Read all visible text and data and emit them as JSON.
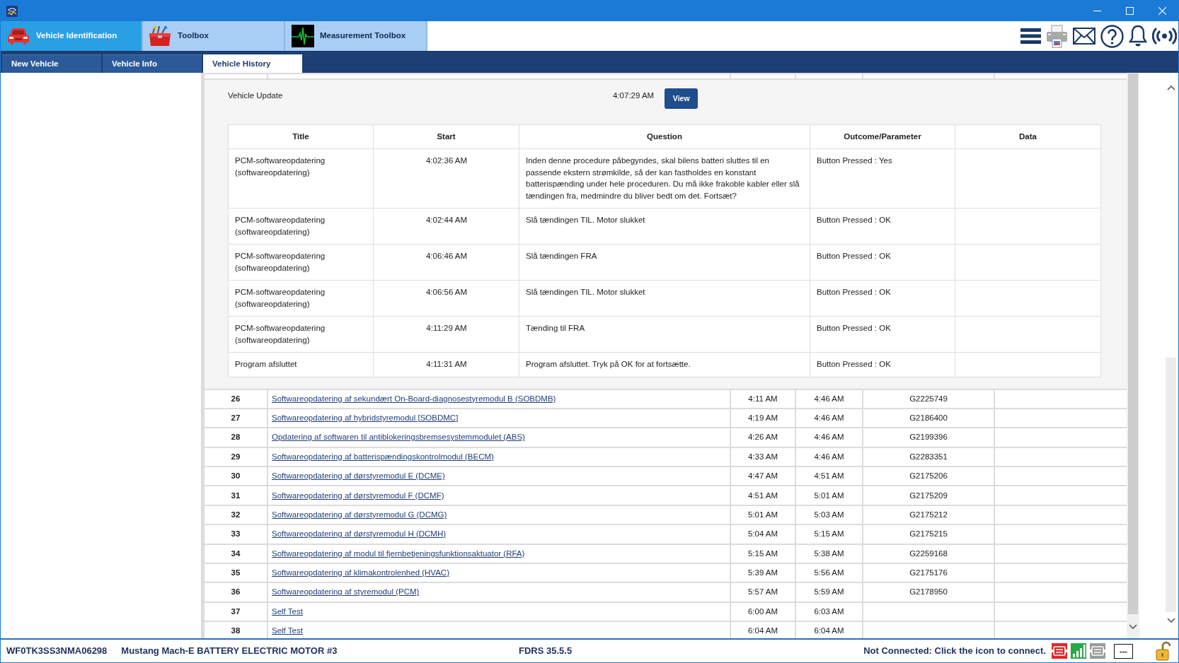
{
  "toolbar": {
    "tabs": [
      {
        "label": "Vehicle Identification",
        "selected": true
      },
      {
        "label": "Toolbox",
        "selected": false
      },
      {
        "label": "Measurement Toolbox",
        "selected": false
      }
    ]
  },
  "subtabs": [
    {
      "label": "New Vehicle",
      "selected": false
    },
    {
      "label": "Vehicle Info",
      "selected": false
    },
    {
      "label": "Vehicle History",
      "selected": true
    }
  ],
  "history": {
    "expanded": {
      "title": "Vehicle Update",
      "time": "4:07:29 AM",
      "button": "View",
      "columns": [
        "Title",
        "Start",
        "Question",
        "Outcome/Parameter",
        "Data"
      ],
      "rows": [
        {
          "title": "PCM-softwareopdatering (softwareopdatering)",
          "start": "4:02:36 AM",
          "question": "Inden denne procedure påbegyndes, skal bilens batteri sluttes til en passende ekstern strømkilde, så der kan fastholdes en konstant batterispænding under hele proceduren. Du må ikke frakoble kabler eller slå tændingen fra, medmindre du bliver bedt om det. Fortsæt?",
          "outcome": "Button Pressed : Yes"
        },
        {
          "title": "PCM-softwareopdatering (softwareopdatering)",
          "start": "4:02:44 AM",
          "question": "Slå tændingen TIL. Motor slukket",
          "outcome": "Button Pressed : OK"
        },
        {
          "title": "PCM-softwareopdatering (softwareopdatering)",
          "start": "4:06:46 AM",
          "question": "Slå tændingen FRA",
          "outcome": "Button Pressed : OK"
        },
        {
          "title": "PCM-softwareopdatering (softwareopdatering)",
          "start": "4:06:56 AM",
          "question": "Slå tændingen TIL. Motor slukket",
          "outcome": "Button Pressed : OK"
        },
        {
          "title": "PCM-softwareopdatering (softwareopdatering)",
          "start": "4:11:29 AM",
          "question": "Tænding til FRA",
          "outcome": "Button Pressed : OK"
        },
        {
          "title": "Program afsluttet",
          "start": "4:11:31 AM",
          "question": "Program afsluttet. Tryk på OK for at fortsætte.",
          "outcome": "Button Pressed : OK"
        }
      ]
    },
    "rows": [
      {
        "column_1": "26",
        "column_2": "Softwareopdatering af sekundært On-Board-diagnosestyremodul B (SOBDMB)",
        "column_3": "4:11 AM",
        "column_4": "4:46 AM",
        "column_5": "G2225749"
      },
      {
        "column_1": "27",
        "column_2": "Softwareopdatering af hybridstyremodul [SOBDMC]",
        "column_3": "4:19 AM",
        "column_4": "4:46 AM",
        "column_5": "G2186400"
      },
      {
        "column_1": "28",
        "column_2": "Opdatering af softwaren til antiblokeringsbremsesystemmodulet (ABS)",
        "column_3": "4:26 AM",
        "column_4": "4:46 AM",
        "column_5": "G2199396"
      },
      {
        "column_1": "29",
        "column_2": "Softwareopdatering af batterispændingskontrolmodul (BECM)",
        "column_3": "4:33 AM",
        "column_4": "4:46 AM",
        "column_5": "G2283351"
      },
      {
        "column_1": "30",
        "column_2": "Softwareopdatering af dørstyremodul E (DCME)",
        "column_3": "4:47 AM",
        "column_4": "4:51 AM",
        "column_5": "G2175206"
      },
      {
        "column_1": "31",
        "column_2": "Softwareopdatering af dørstyremodul F (DCMF)",
        "column_3": "4:51 AM",
        "column_4": "5:01 AM",
        "column_5": "G2175209"
      },
      {
        "column_1": "32",
        "column_2": "Softwareopdatering af dørstyremodul G (DCMG)",
        "column_3": "5:01 AM",
        "column_4": "5:03 AM",
        "column_5": "G2175212"
      },
      {
        "column_1": "33",
        "column_2": "Softwareopdatering af dørstyremodul H (DCMH)",
        "column_3": "5:04 AM",
        "column_4": "5:15 AM",
        "column_5": "G2175215"
      },
      {
        "column_1": "34",
        "column_2": "Softwareopdatering af modul til fjernbetjeningsfunktionsaktuator (RFA)",
        "column_3": "5:15 AM",
        "column_4": "5:38 AM",
        "column_5": "G2259168"
      },
      {
        "column_1": "35",
        "column_2": "Softwareopdatering af klimakontrolenhed (HVAC)",
        "column_3": "5:39 AM",
        "column_4": "5:56 AM",
        "column_5": "G2175176"
      },
      {
        "column_1": "36",
        "column_2": "Softwareopdatering af styremodul (PCM)",
        "column_3": "5:57 AM",
        "column_4": "5:59 AM",
        "column_5": "G2178950"
      },
      {
        "column_1": "37",
        "column_2": "Self Test",
        "column_3": "6:00 AM",
        "column_4": "6:03 AM"
      },
      {
        "column_1": "38",
        "column_2": "Self Test",
        "column_3": "6:04 AM",
        "column_4": "6:04 AM"
      }
    ]
  },
  "status_bar": {
    "vin": "WF0TK3SS3NMA06298",
    "vehicle": "Mustang Mach-E BATTERY ELECTRIC MOTOR #3",
    "version": "FDRS 35.5.5",
    "connection": "Not Connected: Click the icon to connect.",
    "indicator": "---"
  }
}
